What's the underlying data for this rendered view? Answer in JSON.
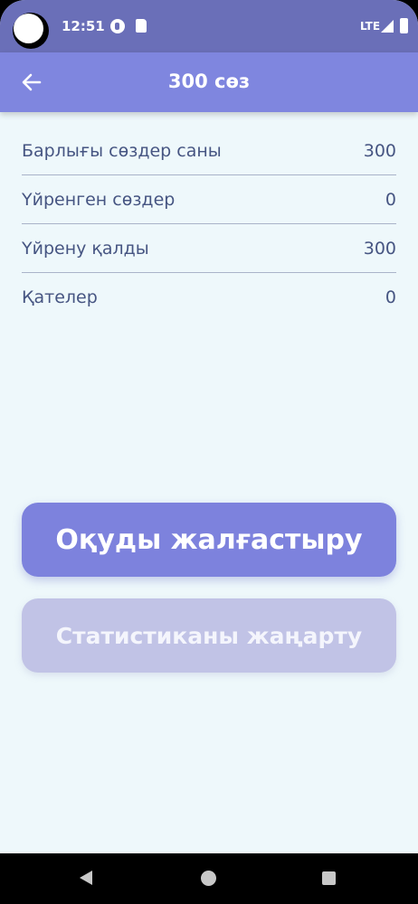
{
  "status_bar": {
    "time": "12:51",
    "network": "LTE",
    "icons": [
      "camera-cutout",
      "notification-icon",
      "sd-card-icon",
      "signal-icon",
      "battery-icon"
    ]
  },
  "app_bar": {
    "back_icon": "arrow-left-icon",
    "title": "300 сөз",
    "color": "#7f86df"
  },
  "stats": [
    {
      "label": "Барлығы сөздер саны",
      "value": "300"
    },
    {
      "label": "Үйренген сөздер",
      "value": "0"
    },
    {
      "label": "Үйрену қалды",
      "value": "300"
    },
    {
      "label": "Қателер",
      "value": "0"
    }
  ],
  "buttons": {
    "continue_label": "Оқуды жалғастыру",
    "refresh_label": "Статистиканы жаңарту",
    "primary_color": "#7d82dd",
    "secondary_color": "#c1c3e6"
  },
  "nav_bar": {
    "icons": [
      "nav-back-icon",
      "nav-home-icon",
      "nav-recents-icon"
    ]
  }
}
